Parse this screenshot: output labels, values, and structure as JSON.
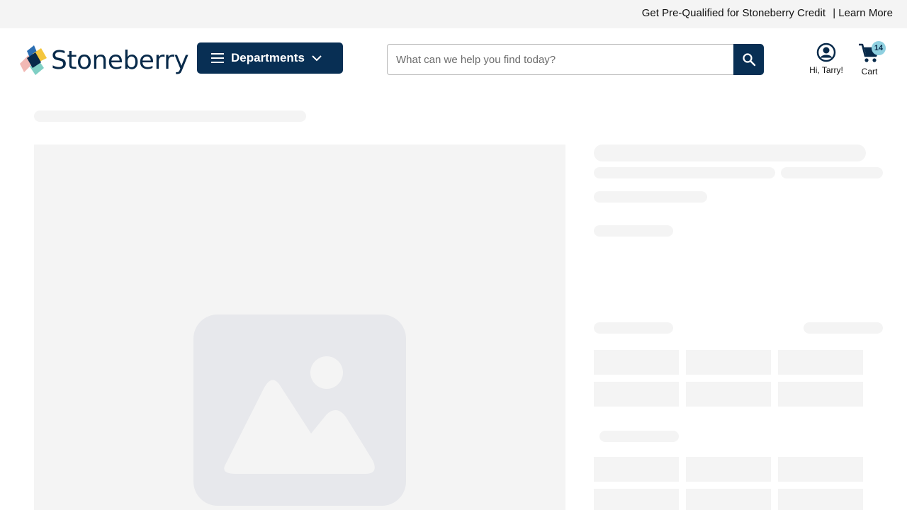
{
  "promo": {
    "text": "Get Pre-Qualified for Stoneberry Credit",
    "separator": "|",
    "link": "Learn More"
  },
  "header": {
    "logo_text": "Stoneberry",
    "departments_label": "Departments",
    "search": {
      "placeholder": "What can we help you find today?",
      "value": ""
    },
    "account_label": "Hi, Tarry!",
    "cart_label": "Cart",
    "cart_count": "14"
  },
  "colors": {
    "navy": "#082f54",
    "badge": "#8fd0e0",
    "skeleton": "#f4f4f4",
    "placeholder_icon": "#e7e8ec"
  },
  "icons": [
    "hamburger-icon",
    "chevron-down-icon",
    "search-icon",
    "account-icon",
    "cart-icon",
    "image-placeholder-icon"
  ]
}
